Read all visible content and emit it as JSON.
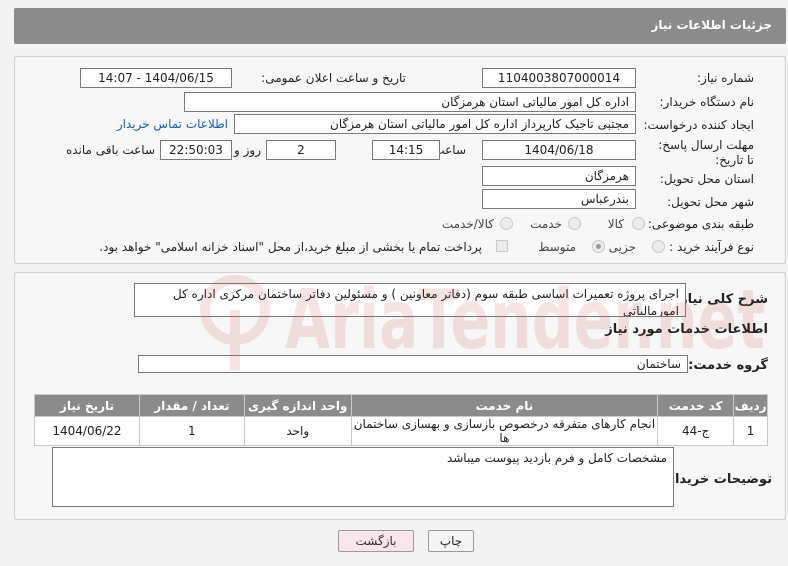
{
  "header": {
    "title": "جزئیات اطلاعات نیاز"
  },
  "fields": {
    "need_number_label": "شماره نیاز:",
    "need_number": "1104003807000014",
    "announce_label": "تاریخ و ساعت اعلان عمومی:",
    "announce_value": "1404/06/15 - 14:07",
    "buyer_org_label": "نام دستگاه خریدار:",
    "buyer_org": "اداره کل امور مالیاتی استان هرمزگان",
    "creator_label": "ایجاد کننده درخواست:",
    "creator": "مجتبی تاجیک کارپرداز اداره کل امور مالیاتی استان هرمزگان",
    "contact_link": "اطلاعات تماس خریدار",
    "deadline_label": "مهلت ارسال پاسخ: تا تاریخ:",
    "deadline_date": "1404/06/18",
    "time_label": "ساعت",
    "deadline_time": "14:15",
    "days_value": "2",
    "days_label": "روز و",
    "remaining_time": "22:50:03",
    "remaining_label": "ساعت باقی مانده",
    "province_label": "استان محل تحویل:",
    "province": "هرمزگان",
    "city_label": "شهر محل تحویل:",
    "city": "بندرعباس",
    "category_label": "طبقه بندی موضوعی:",
    "category_options": [
      "کالا",
      "خدمت",
      "کالا/خدمت"
    ],
    "process_label": "نوع فرآیند خرید :",
    "process_options": [
      "جزیی",
      "متوسط"
    ],
    "payment_note": "پرداخت تمام یا بخشی از مبلغ خرید،از محل \"اسناد خزانه اسلامی\" خواهد بود."
  },
  "summary": {
    "label": "شرح کلی نیاز:",
    "text": "اجرای پروژه تعمیرات اساسی طبقه سوم (دفاتر معاونین ) و مسئولین دفاتر ساختمان مرکزی اداره کل امورمالیاتی"
  },
  "services": {
    "section_title": "اطلاعات خدمات مورد نیاز",
    "group_label": "گروه خدمت:",
    "group_value": "ساختمان",
    "columns": [
      "ردیف",
      "کد خدمت",
      "نام خدمت",
      "واحد اندازه گیری",
      "تعداد / مقدار",
      "تاریخ نیاز"
    ],
    "rows": [
      [
        "1",
        "ج-44",
        "انجام کارهای متفرقه درخصوص بازسازی و بهسازی ساختمان ها",
        "واحد",
        "1",
        "1404/06/22"
      ]
    ]
  },
  "buyer_notes": {
    "label": "توضیحات خریدار:",
    "text": "مشخصات کامل و فرم بازدید پیوست میباشد"
  },
  "buttons": {
    "print": "چاپ",
    "back": "بازگشت"
  },
  "watermark": {
    "text": "AriaTender.net"
  },
  "colors": {
    "header": "#8b8b8b",
    "link": "#1a5fb4",
    "watermark": "#c0392b"
  }
}
